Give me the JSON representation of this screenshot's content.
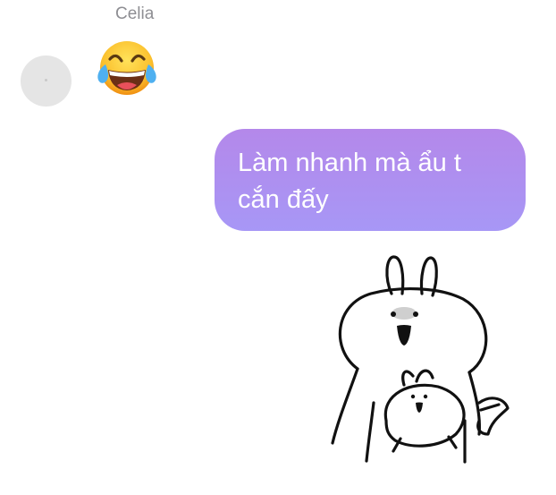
{
  "conversation": {
    "sender_name": "Celia",
    "incoming": {
      "type": "emoji",
      "emoji_name": "face-with-tears-of-joy"
    },
    "outgoing_text": "Làm nhanh mà ẩu t\ncắn đấy",
    "outgoing_sticker": "bunny-holding-small-bunny-sticker"
  },
  "colors": {
    "bubble_top": "#b488ea",
    "bubble_bottom": "#a797f6",
    "bubble_text": "#ffffff",
    "sender_name": "#8e8e93",
    "avatar": "#e5e5e5"
  }
}
